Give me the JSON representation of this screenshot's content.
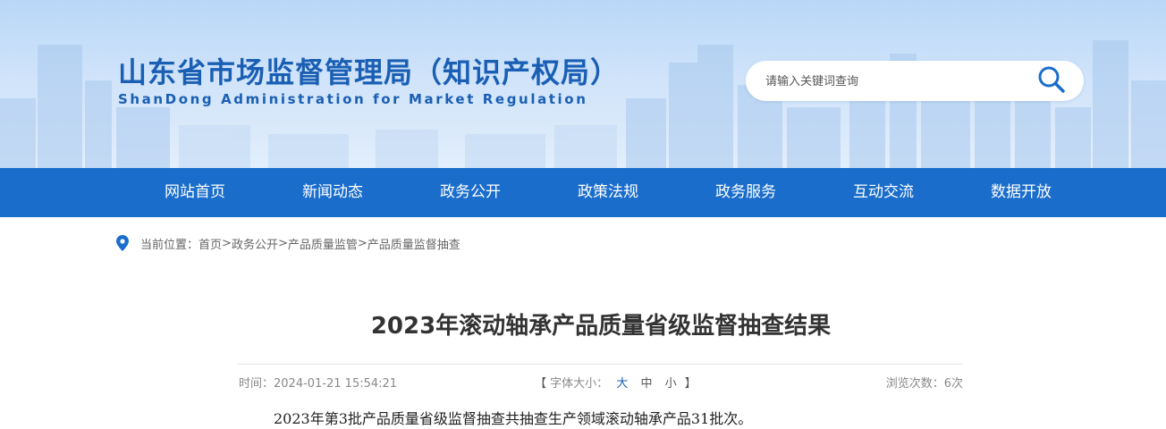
{
  "header": {
    "title": "山东省市场监督管理局（知识产权局）",
    "subtitle": "ShanDong Administration for Market Regulation"
  },
  "search": {
    "placeholder": "请输入关键词查询",
    "icon": "search-icon"
  },
  "nav": {
    "items": [
      {
        "label": "网站首页"
      },
      {
        "label": "新闻动态"
      },
      {
        "label": "政务公开"
      },
      {
        "label": "政策法规"
      },
      {
        "label": "政务服务"
      },
      {
        "label": "互动交流"
      },
      {
        "label": "数据开放"
      }
    ]
  },
  "breadcrumb": {
    "prefix": "当前位置：",
    "items": [
      "首页",
      "政务公开",
      "产品质量监管",
      "产品质量监督抽查"
    ],
    "separator": ">"
  },
  "article": {
    "title": "2023年滚动轴承产品质量省级监督抽查结果",
    "time": "时间：2024-01-21 15:54:21",
    "font_label": "字体大小：",
    "font_large": "大",
    "font_medium": "中",
    "font_small": "小",
    "bracket_open": "【",
    "bracket_close": "】",
    "views": "浏览次数：6次",
    "paragraph": "2023年第3批产品质量省级监督抽查共抽查生产领域滚动轴承产品31批次。"
  },
  "colors": {
    "brand": "#1a5fb4",
    "nav_bg": "#1a6dcb",
    "banner_bg": "#b9d7f7"
  }
}
